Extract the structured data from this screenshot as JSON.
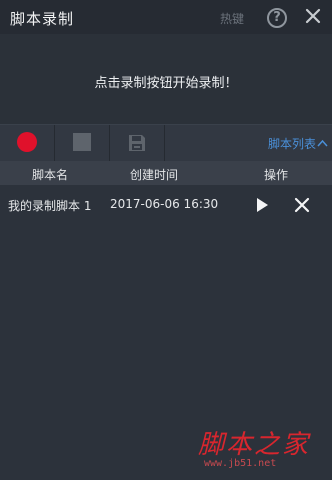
{
  "window": {
    "title": "脚本录制",
    "hotkey_label": "热键"
  },
  "prompt": {
    "text": "点击录制按钮开始录制！"
  },
  "toolbar": {
    "record_icon": "record-icon",
    "stop_icon": "stop-icon",
    "save_icon": "save-icon",
    "script_list_label": "脚本列表"
  },
  "table": {
    "headers": [
      "脚本名",
      "创建时间",
      "操作"
    ],
    "rows": [
      {
        "name": "我的录制脚本 1",
        "created": "2017-06-06 16:30"
      }
    ]
  },
  "watermark": {
    "text": "脚本之家",
    "url": "www.jb51.net"
  },
  "colors": {
    "background": "#2c323b",
    "record_red": "#e0112b",
    "link_blue": "#4a90d9"
  }
}
